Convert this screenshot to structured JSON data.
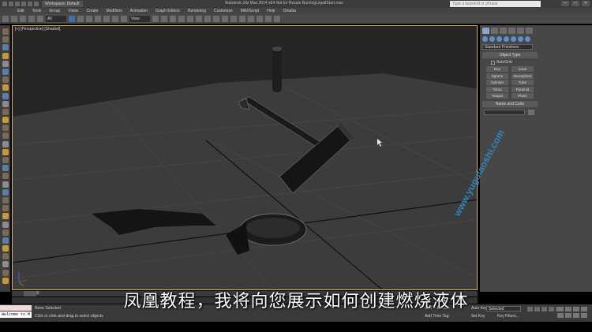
{
  "titlebar": {
    "workspace": "Workspace: Default",
    "window_title": "Autodesk 3ds Max 2014 x64    Not for Resale    BurningLiquidStart.max",
    "search_placeholder": "Type a keyword or phrase",
    "controls": [
      "—",
      "□",
      "✕"
    ]
  },
  "menu": [
    "Edit",
    "Tools",
    "Group",
    "Views",
    "Create",
    "Modifiers",
    "Animation",
    "Graph Editors",
    "Rendering",
    "Customize",
    "MAXScript",
    "Help",
    "Omaha"
  ],
  "toolbar": {
    "selection_filter": "All",
    "ref_coord": "View"
  },
  "viewport": {
    "label": "[+] [Perspective] [Shaded]"
  },
  "command_panel": {
    "category": "Standard Primitives",
    "object_type_title": "Object Type",
    "autogrid_label": "AutoGrid",
    "primitives": [
      "Box",
      "Cone",
      "Sphere",
      "GeoSphere",
      "Cylinder",
      "Tube",
      "Torus",
      "Pyramid",
      "Teapot",
      "Plane"
    ],
    "name_color_title": "Name and Color"
  },
  "watermark": "www.yuguiaoshi.com",
  "timeline": {
    "frame_counter": "0 / 80"
  },
  "status": {
    "maxscript_text": "Welcome to M",
    "selection": "None Selected",
    "prompt": "Click or click-and-drag to select objects",
    "grid": "Grid = 10.0cm",
    "add_time_tag": "Add Time Tag",
    "auto_key": "Auto Key",
    "selected_dropdown": "Selected",
    "set_key": "Set Key",
    "key_filters": "Key Filters..."
  },
  "subtitle": "凤凰教程，我将向您展示如何创建燃烧液体"
}
